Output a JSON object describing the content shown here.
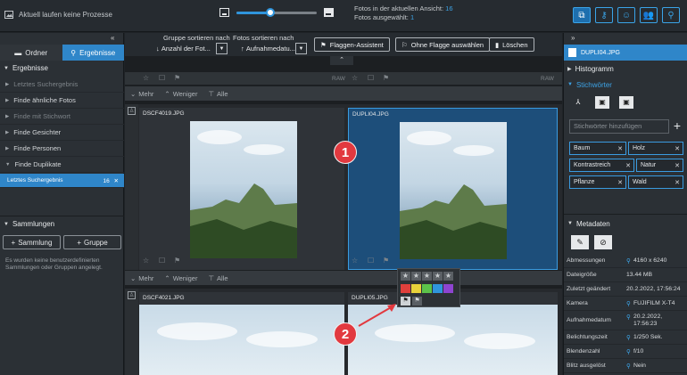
{
  "top": {
    "process_status": "Aktuell laufen keine Prozesse",
    "zoom_percent": 42,
    "view_count_label": "Fotos in der aktuellen Ansicht:",
    "view_count": "16",
    "selected_label": "Fotos ausgewählt:",
    "selected_count": "1",
    "icons": [
      "copy-icon",
      "key-icon",
      "face-icon",
      "people-icon",
      "search-icon"
    ]
  },
  "left": {
    "collapse_glyph": "«",
    "tabs": [
      {
        "label": "Ordner",
        "icon": "folder-icon",
        "active": false
      },
      {
        "label": "Ergebnisse",
        "icon": "search-icon",
        "active": true
      }
    ],
    "results_header": "Ergebnisse",
    "results_items": [
      {
        "label": "Letztes Suchergebnis",
        "dim": true
      },
      {
        "label": "Finde ähnliche Fotos",
        "dim": false
      },
      {
        "label": "Finde mit Stichwort",
        "dim": true
      },
      {
        "label": "Finde Gesichter",
        "dim": false
      },
      {
        "label": "Finde Personen",
        "dim": false
      },
      {
        "label": "Finde Duplikate",
        "dim": false,
        "expanded": true
      }
    ],
    "sub_item": {
      "label": "Letztes Suchergebnis",
      "count": "16"
    },
    "collections_header": "Sammlungen",
    "add_collection": "Sammlung",
    "add_group": "Gruppe",
    "empty_note": "Es wurden keine benutzerdefinierten Sammlungen oder Gruppen angelegt."
  },
  "center": {
    "group_header": "Gruppe sortieren nach",
    "group_value": "Anzahl der Fot...",
    "sort_header": "Fotos sortieren nach",
    "sort_value": "Aufnahmedatu...",
    "btn_flag_assistant": "Flaggen-Assistent",
    "btn_no_flag": "Ohne Flagge auswählen",
    "btn_delete": "Löschen",
    "raw_label": "RAW",
    "more_label": "Mehr",
    "less_label": "Weniger",
    "all_label": "Alle",
    "photos_row1": [
      {
        "name": "DSCF4019.JPG",
        "selected": false
      },
      {
        "name": "DUPLI04.JPG",
        "selected": true
      }
    ],
    "photos_row2": [
      {
        "name": "DSCF4021.JPG",
        "selected": false
      },
      {
        "name": "DUPLI05.JPG",
        "selected": false
      }
    ],
    "popup_colors": [
      "#e0403c",
      "#e8d23a",
      "#5cc24a",
      "#2f95dc",
      "#8e44d0"
    ],
    "annotations": [
      "1",
      "2"
    ]
  },
  "right": {
    "expand_glyph": "»",
    "file_name": "DUPLI04.JPG",
    "histogram": "Histogramm",
    "keywords_header": "Stichwörter",
    "keyword_placeholder": "Stichwörter hinzufügen",
    "tags": [
      "Baum",
      "Holz",
      "Kontrastreich",
      "Natur",
      "Pflanze",
      "Wald"
    ],
    "metadata_header": "Metadaten",
    "metadata": [
      {
        "k": "Abmessungen",
        "v": "4160 x 6240",
        "q": true
      },
      {
        "k": "Dateigröße",
        "v": "13.44 MB",
        "q": false
      },
      {
        "k": "Zuletzt geändert",
        "v": "20.2.2022, 17:56:24",
        "q": false
      },
      {
        "k": "Kamera",
        "v": "FUJIFILM X-T4",
        "q": true
      },
      {
        "k": "Aufnahmedatum",
        "v": "20.2.2022, 17:56:23",
        "q": true
      },
      {
        "k": "Belichtungszeit",
        "v": "1/250 Sek.",
        "q": true
      },
      {
        "k": "Blendenzahl",
        "v": "f/10",
        "q": true
      },
      {
        "k": "Blitz ausgelöst",
        "v": "Nein",
        "q": true
      }
    ]
  }
}
